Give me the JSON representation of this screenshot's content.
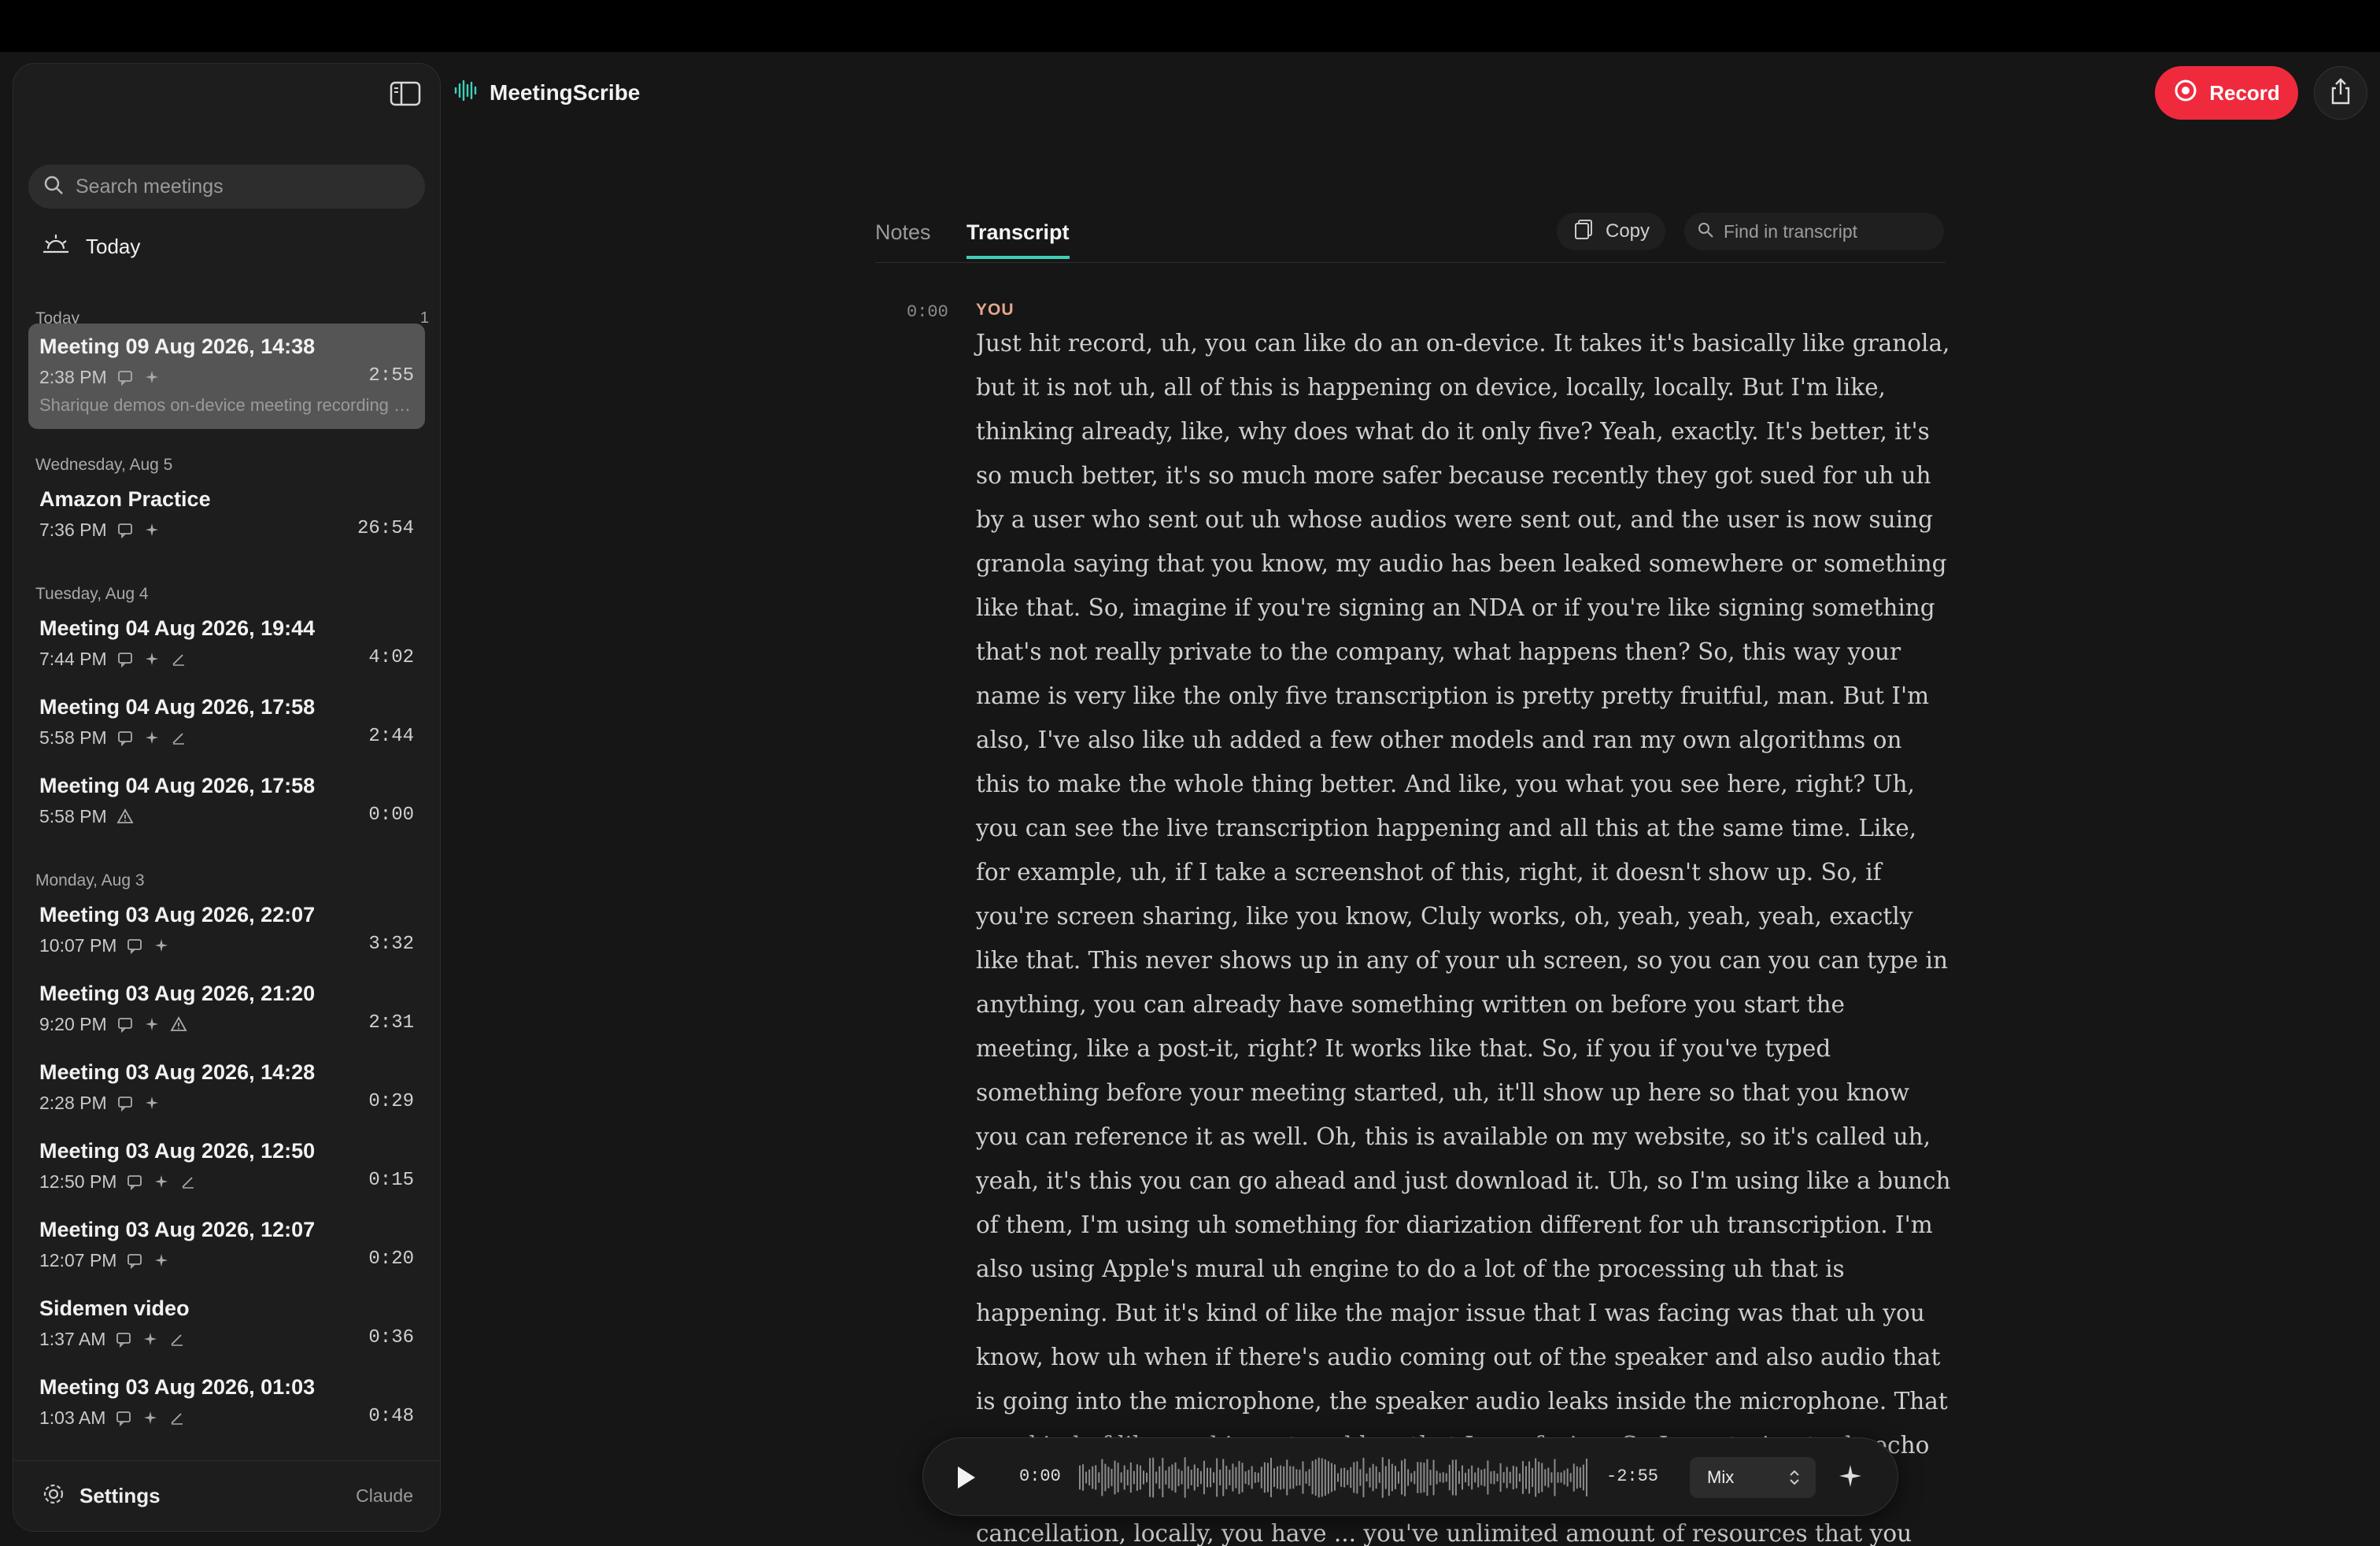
{
  "app": {
    "title": "MeetingScribe"
  },
  "header": {
    "record_label": "Record"
  },
  "sidebar": {
    "search_placeholder": "Search meetings",
    "today_filter_label": "Today",
    "groups": [
      {
        "label": "Today",
        "count": "1"
      },
      {
        "label": "Wednesday, Aug 5"
      },
      {
        "label": "Tuesday, Aug 4"
      },
      {
        "label": "Monday, Aug 3"
      }
    ],
    "meetings": [
      {
        "title": "Meeting 09 Aug 2026, 14:38",
        "time": "2:38 PM",
        "duration": "2:55",
        "summary": "Sharique demos on-device meeting recording app"
      },
      {
        "title": "Amazon Practice",
        "time": "7:36 PM",
        "duration": "26:54"
      },
      {
        "title": "Meeting 04 Aug 2026, 19:44",
        "time": "7:44 PM",
        "duration": "4:02"
      },
      {
        "title": "Meeting 04 Aug 2026, 17:58",
        "time": "5:58 PM",
        "duration": "2:44"
      },
      {
        "title": "Meeting 04 Aug 2026, 17:58",
        "time": "5:58 PM",
        "duration": "0:00"
      },
      {
        "title": "Meeting 03 Aug 2026, 22:07",
        "time": "10:07 PM",
        "duration": "3:32"
      },
      {
        "title": "Meeting 03 Aug 2026, 21:20",
        "time": "9:20 PM",
        "duration": "2:31"
      },
      {
        "title": "Meeting 03 Aug 2026, 14:28",
        "time": "2:28 PM",
        "duration": "0:29"
      },
      {
        "title": "Meeting 03 Aug 2026, 12:50",
        "time": "12:50 PM",
        "duration": "0:15"
      },
      {
        "title": "Meeting 03 Aug 2026, 12:07",
        "time": "12:07 PM",
        "duration": "0:20"
      },
      {
        "title": "Sidemen video",
        "time": "1:37 AM",
        "duration": "0:36"
      },
      {
        "title": "Meeting 03 Aug 2026, 01:03",
        "time": "1:03 AM",
        "duration": "0:48"
      }
    ],
    "footer": {
      "settings_label": "Settings",
      "model_label": "Claude"
    }
  },
  "main": {
    "tabs": {
      "notes": "Notes",
      "transcript": "Transcript"
    },
    "copy_label": "Copy",
    "find_placeholder": "Find in transcript",
    "segment": {
      "timestamp": "0:00",
      "speaker": "YOU",
      "text": "Just hit record, uh, you can like do an on-device. It takes it's basically like granola, but it is not uh, all of this is happening on device, locally, locally. But I'm like, thinking already, like, why does what do it only five? Yeah, exactly. It's better, it's so much better, it's so much more safer because recently they got sued for uh uh by a user who sent out uh whose audios were sent out, and the user is now suing granola saying that you know, my audio has been leaked somewhere or something like that. So, imagine if you're signing an NDA or if you're like signing something that's not really private to the company, what happens then? So, this way your name is very like the only five transcription is pretty pretty fruitful, man. But I'm also, I've also like uh added a few other models and ran my own algorithms on this to make the whole thing better. And like, you what you see here, right? Uh, you can see the live transcription happening and all this at the same time. Like, for example, uh, if I take a screenshot of this, right, it doesn't show up. So, if you're screen sharing, like you know, Cluly works, oh, yeah, yeah, yeah, exactly like that. This never shows up in any of your uh screen, so you can you can type in anything, you can already have something written on before you start the meeting, like a post-it, right? It works like that. So, if you if you've typed something before your meeting started, uh, it'll show up here so that you know you can reference it as well. Oh, this is available on my website, so it's called uh, yeah, it's this you can go ahead and just download it. Uh, so I'm using like a bunch of them, I'm using uh something for diarization different for uh transcription. I'm also using Apple's mural uh engine to do a lot of the processing uh that is happening. But it's kind of like the major issue that I was facing was that uh you know, how uh when if there's audio coming out of the speaker and also audio that is going into the microphone, the speaker audio leaks inside the microphone. That was kind of like my biggest problem that I was facing. So I was trying to do echo cancellation. If you know what that is, it's basically. So trying to do echo cancellation, locally, you have ... you've unlimited amount of resources that you can see in the cloud, right? But here I'm limited"
    }
  },
  "player": {
    "current_time": "0:00",
    "remaining_time": "-2:55",
    "mode": "Mix",
    "progress": 0
  },
  "colors": {
    "accent": "#3ed0b8",
    "record": "#ef2a3d",
    "speaker": "#e6a68a"
  }
}
